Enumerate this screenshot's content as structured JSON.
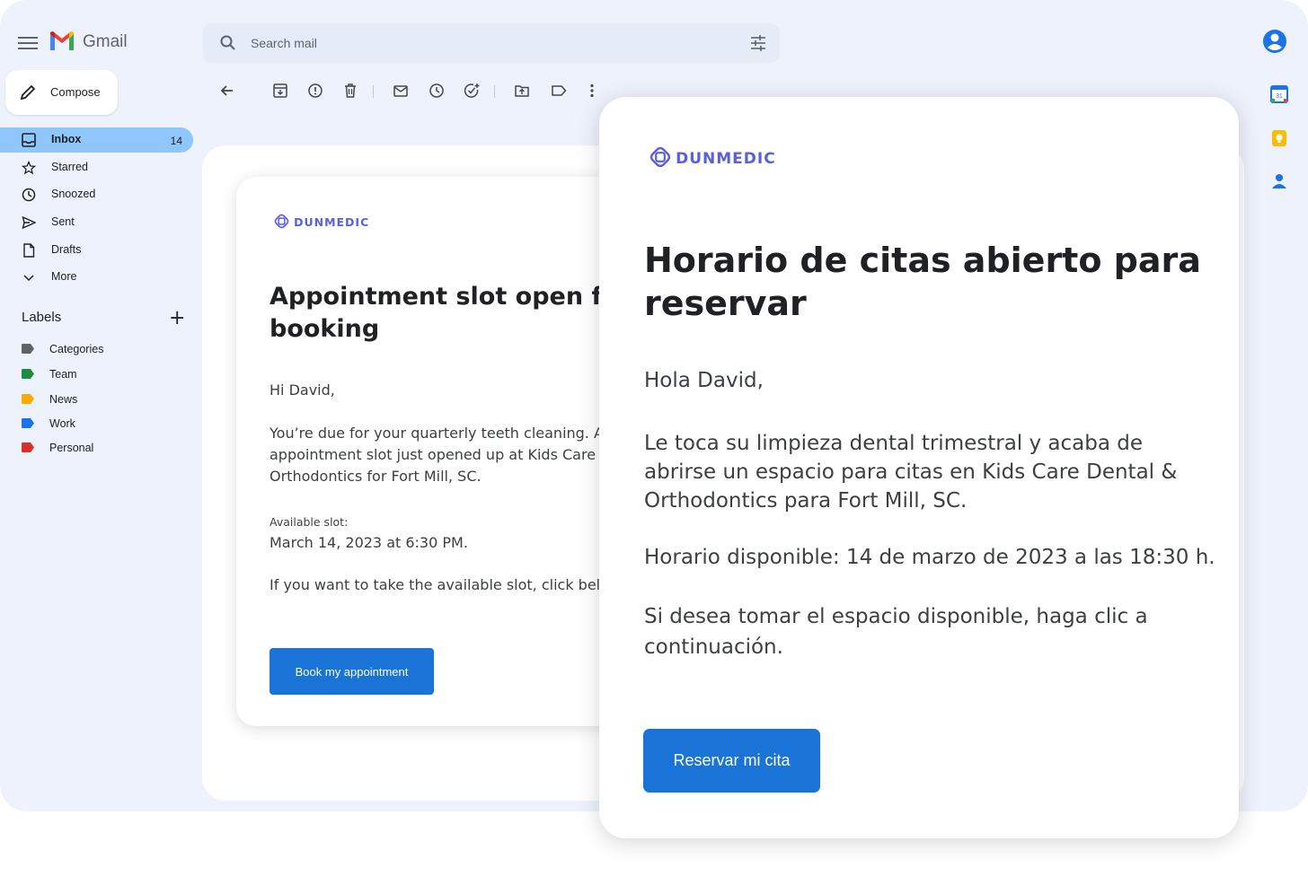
{
  "app": {
    "name": "Gmail"
  },
  "search": {
    "placeholder": "Search mail"
  },
  "compose": {
    "label": "Compose"
  },
  "nav": [
    {
      "label": "Inbox",
      "count": "14",
      "icon": "inbox-icon"
    },
    {
      "label": "Starred",
      "icon": "star-icon"
    },
    {
      "label": "Snoozed",
      "icon": "clock-icon"
    },
    {
      "label": "Sent",
      "icon": "send-icon"
    },
    {
      "label": "Drafts",
      "icon": "draft-icon"
    },
    {
      "label": "More",
      "icon": "chevron-down-icon"
    }
  ],
  "labels": {
    "heading": "Labels",
    "items": [
      {
        "label": "Categories",
        "color": "#5f6368"
      },
      {
        "label": "Team",
        "color": "#1e8e3e"
      },
      {
        "label": "News",
        "color": "#f9ab00"
      },
      {
        "label": "Work",
        "color": "#1a73e8"
      },
      {
        "label": "Personal",
        "color": "#d93025"
      }
    ]
  },
  "email_en": {
    "brand": "DUNMEDIC",
    "title": "Appointment slot open for booking",
    "greeting": "Hi David,",
    "body": "You’re due for your quarterly teeth cleaning. An appointment slot just opened up at Kids Care Dental & Orthodontics for Fort Mill, SC.",
    "slot_label": "Available slot:",
    "slot_value": "March 14, 2023 at 6:30 PM.",
    "cta_text": "If you want to take the available slot, click below.",
    "button": "Book my appointment"
  },
  "email_es": {
    "brand": "DUNMEDIC",
    "title": "Horario de citas abierto para reservar",
    "greeting": "Hola David,",
    "body": "Le toca su limpieza dental trimestral y acaba de abrirse un espacio para citas en Kids Care Dental & Orthodontics para Fort Mill, SC.",
    "slot": "Horario disponible: 14 de marzo de 2023 a las 18:30 h.",
    "cta_text": "Si desea tomar el espacio disponible, haga clic a continuación.",
    "button": "Reservar mi cita"
  },
  "colors": {
    "accent": "#1a73d6",
    "inbox_highlight": "#8fc6fb",
    "brand": "#5a5fe0",
    "background": "#eef2fc"
  }
}
